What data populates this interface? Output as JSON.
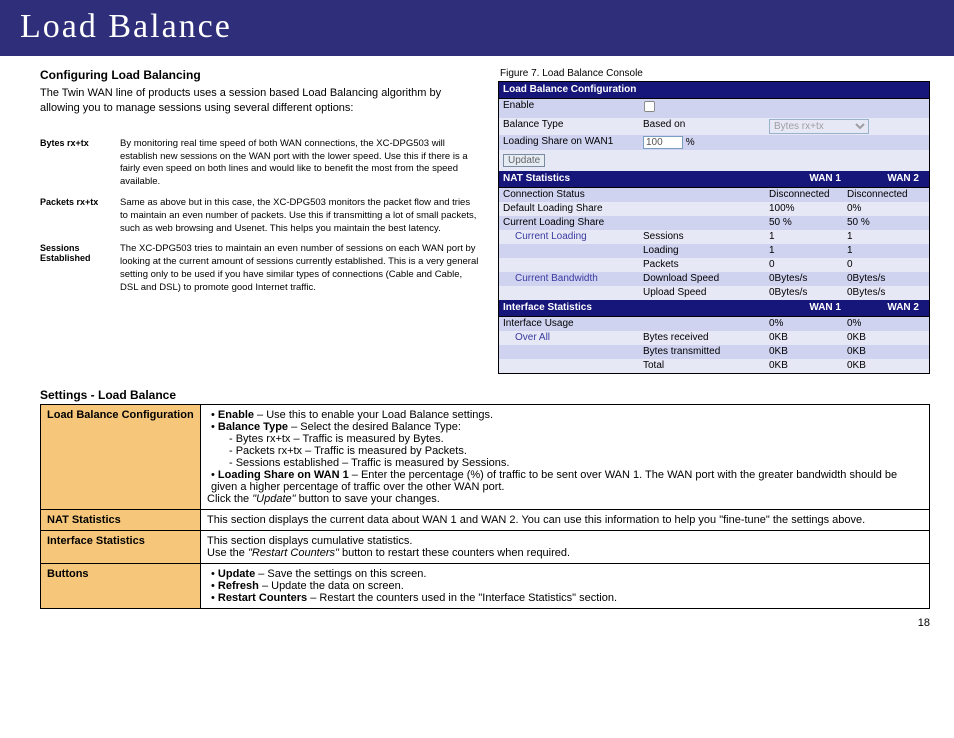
{
  "banner": "Load Balance",
  "page_number": "18",
  "left": {
    "heading": "Configuring Load Balancing",
    "intro": "The Twin WAN line of products uses a session based Load Balancing algorithm by allowing you to manage sessions using several different options:",
    "options": [
      {
        "term": "Bytes rx+tx",
        "desc": "By monitoring real time speed of both WAN connections, the XC-DPG503 will establish new sessions on the WAN port with the lower speed. Use this if there is a fairly even speed on both lines and would like to benefit the most from the speed available."
      },
      {
        "term": "Packets rx+tx",
        "desc": "Same as above but in this case, the XC-DPG503 monitors the packet flow and tries to maintain an even number of packets. Use this if transmitting a lot of small packets, such as web browsing and Usenet. This helps you maintain the best latency."
      },
      {
        "term": "Sessions Established",
        "desc": "The XC-DPG503 tries to maintain an even number of sessions on each WAN port by looking at the current amount of sessions currently established. This is a very general setting only to be used if you have similar types of connections (Cable and Cable, DSL and DSL) to promote good Internet traffic."
      }
    ]
  },
  "figure": {
    "caption": "Figure 7.  Load Balance Console",
    "config_hdr": "Load Balance Configuration",
    "enable_label": "Enable",
    "balance_type_label": "Balance Type",
    "balance_type_text": "Based on",
    "balance_type_option": "Bytes rx+tx",
    "loading_share_label": "Loading Share on WAN1",
    "loading_share_value": "100",
    "loading_share_unit": "%",
    "update_btn": "Update",
    "nat_hdr": "NAT Statistics",
    "wan1": "WAN 1",
    "wan2": "WAN 2",
    "rows_nat": [
      {
        "k": "Connection Status",
        "v1": "Disconnected",
        "v2": "Disconnected"
      },
      {
        "k": "Default Loading Share",
        "v1": "100%",
        "v2": "0%"
      },
      {
        "k": "Current Loading Share",
        "v1": "50 %",
        "v2": "50 %"
      }
    ],
    "cur_loading": "Current Loading",
    "cur_loading_rows": [
      {
        "k": "Sessions",
        "v1": "1",
        "v2": "1"
      },
      {
        "k": "Loading",
        "v1": "1",
        "v2": "1"
      },
      {
        "k": "Packets",
        "v1": "0",
        "v2": "0"
      }
    ],
    "cur_bw": "Current Bandwidth",
    "cur_bw_rows": [
      {
        "k": "Download Speed",
        "v1": "0Bytes/s",
        "v2": "0Bytes/s"
      },
      {
        "k": "Upload Speed",
        "v1": "0Bytes/s",
        "v2": "0Bytes/s"
      }
    ],
    "if_hdr": "Interface Statistics",
    "if_usage": {
      "k": "Interface Usage",
      "v1": "0%",
      "v2": "0%"
    },
    "overall": "Over All",
    "overall_rows": [
      {
        "k": "Bytes received",
        "v1": "0KB",
        "v2": "0KB"
      },
      {
        "k": "Bytes transmitted",
        "v1": "0KB",
        "v2": "0KB"
      },
      {
        "k": "Total",
        "v1": "0KB",
        "v2": "0KB"
      }
    ]
  },
  "settings": {
    "heading": "Settings - Load Balance",
    "rows": [
      {
        "key": "Load Balance Configuration",
        "items": [
          {
            "bold": "Enable",
            "text": " – Use this to enable your Load Balance settings."
          },
          {
            "bold": "Balance Type",
            "text": " – Select the desired Balance Type:"
          }
        ],
        "subitems": [
          "- Bytes rx+tx – Traffic is measured by Bytes.",
          "- Packets rx+tx – Traffic is measured by Packets.",
          "- Sessions established – Traffic is measured by Sessions."
        ],
        "items2": [
          {
            "bold": "Loading Share on WAN 1",
            "text": " – Enter the percentage (%) of traffic to be sent over WAN 1. The WAN port with the greater bandwidth should be given a higher percentage of traffic over the other WAN port."
          }
        ],
        "tail_pre": "Click the ",
        "tail_ital": "\"Update\"",
        "tail_post": " button to save your changes."
      },
      {
        "key": "NAT Statistics",
        "plain": "This section displays the current data about WAN 1 and WAN 2. You can use this information to help you \"fine-tune\" the settings above."
      },
      {
        "key": "Interface Statistics",
        "line1": "This section displays cumulative statistics.",
        "line2_pre": "Use the ",
        "line2_ital": "\"Restart Counters\"",
        "line2_post": " button to restart these counters when required."
      },
      {
        "key": "Buttons",
        "items": [
          {
            "bold": "Update",
            "text": " –  Save the settings on this screen."
          },
          {
            "bold": "Refresh",
            "text": " – Update the data on screen."
          },
          {
            "bold": "Restart Counters",
            "text": " – Restart the counters used in the \"Interface Statistics\" section."
          }
        ]
      }
    ]
  }
}
